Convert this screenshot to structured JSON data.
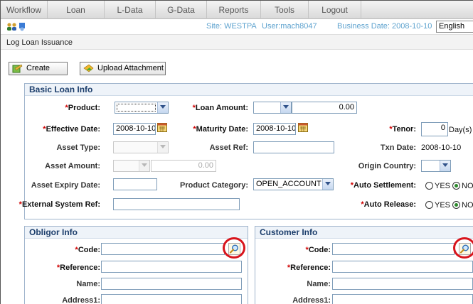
{
  "menu": [
    "Workflow",
    "Loan",
    "L-Data",
    "G-Data",
    "Reports",
    "Tools",
    "Logout"
  ],
  "info": {
    "site": "Site: WESTPA",
    "user": "User:mach8047",
    "business_date": "Business Date: 2008-10-10",
    "language": "English"
  },
  "page_title": "Log Loan Issuance",
  "toolbar": {
    "create": "Create",
    "upload": "Upload Attachment"
  },
  "basic": {
    "title": "Basic Loan Info",
    "product_label": "Product:",
    "loan_amount_label": "Loan Amount:",
    "loan_amount_value": "0.00",
    "effective_date_label": "Effective Date:",
    "effective_date_value": "2008-10-10",
    "maturity_date_label": "Maturity Date:",
    "maturity_date_value": "2008-10-10",
    "tenor_label": "Tenor:",
    "tenor_value": "0",
    "tenor_unit": "Day(s)",
    "asset_type_label": "Asset Type:",
    "asset_ref_label": "Asset Ref:",
    "txn_date_label": "Txn Date:",
    "txn_date_value": "2008-10-10",
    "asset_amount_label": "Asset Amount:",
    "asset_amount_value": "0.00",
    "origin_country_label": "Origin Country:",
    "asset_expiry_label": "Asset Expiry Date:",
    "product_category_label": "Product Category:",
    "product_category_value": "OPEN_ACCOUNT",
    "auto_settlement_label": "Auto Settlement:",
    "auto_release_label": "Auto Release:",
    "external_ref_label": "External System Ref:",
    "yes": "YES",
    "no": "NO"
  },
  "obligor": {
    "title": "Obligor Info",
    "code_label": "Code:",
    "reference_label": "Reference:",
    "name_label": "Name:",
    "address1_label": "Address1:"
  },
  "customer": {
    "title": "Customer Info",
    "code_label": "Code:",
    "reference_label": "Reference:",
    "name_label": "Name:",
    "address1_label": "Address1:"
  },
  "colors": {
    "required": "#d00000",
    "highlight_ring": "#d8141c",
    "info_text": "#5fa3cf"
  }
}
